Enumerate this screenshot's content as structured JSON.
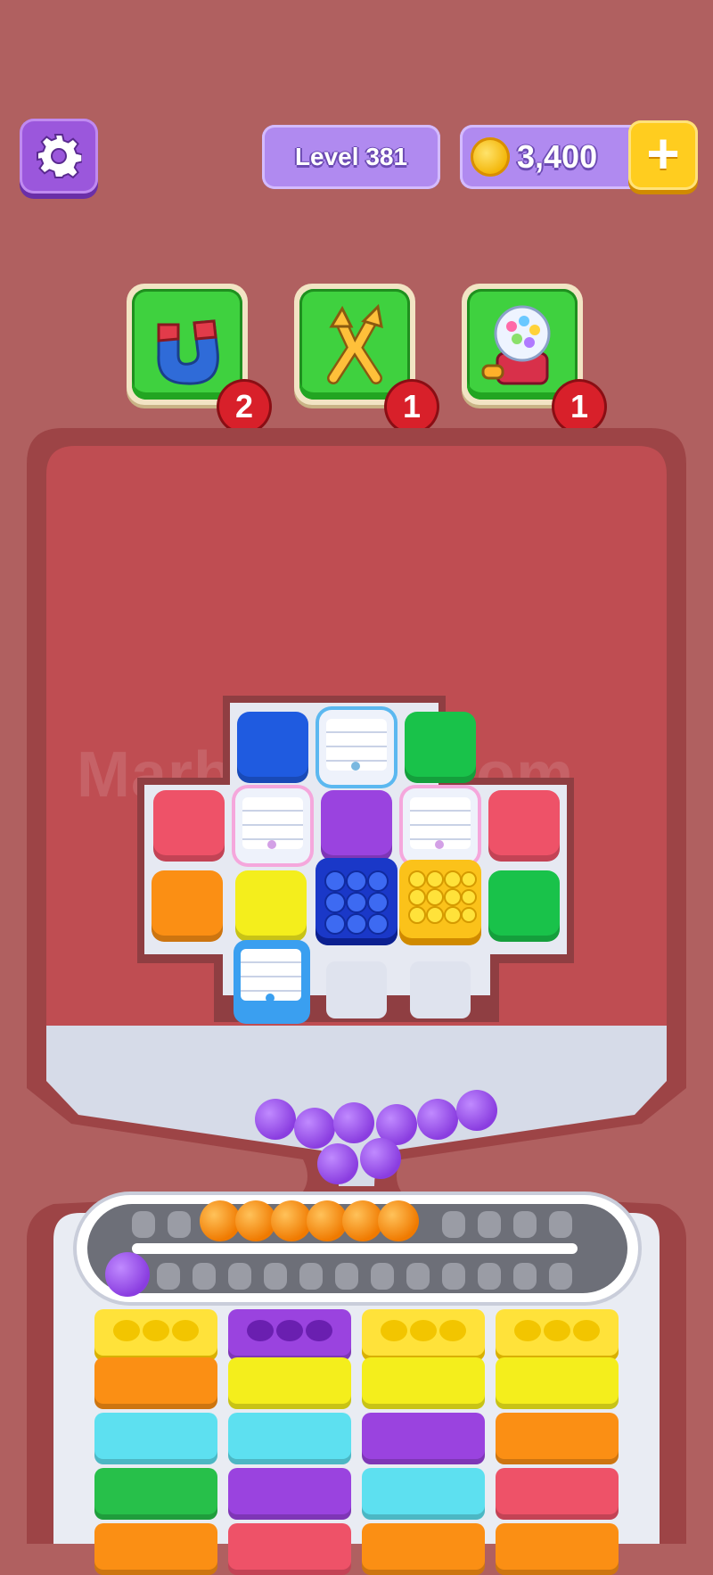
{
  "hud": {
    "level_label": "Level 381",
    "coins": "3,400",
    "plus_label": "+"
  },
  "boosters": [
    {
      "name": "magnet",
      "count": "2"
    },
    {
      "name": "shuffle",
      "count": "1"
    },
    {
      "name": "gumball-machine",
      "count": "1"
    }
  ],
  "watermark": "MarbleSort.com",
  "colors": {
    "background": "#b06060",
    "accent_purple": "#9b57dc",
    "booster_green": "#3fd13f",
    "badge_red": "#d8202a"
  },
  "board": {
    "rows": [
      [
        "",
        "blue",
        "crate-blue",
        "green",
        ""
      ],
      [
        "red",
        "crate-pink",
        "purple",
        "crate-pink",
        "red"
      ],
      [
        "orange",
        "yellow",
        "pop-blue",
        "pop-yellow",
        "green"
      ],
      [
        "",
        "crate-blue",
        "empty",
        "empty",
        ""
      ]
    ]
  },
  "queue_balls": [
    "purple",
    "purple",
    "purple",
    "purple",
    "purple",
    "purple",
    "purple",
    "purple"
  ],
  "conveyor_balls": [
    "orange",
    "orange",
    "orange",
    "orange",
    "orange",
    "orange"
  ],
  "conveyor_loose_ball": "purple",
  "columns": [
    [
      "yellow",
      "orange",
      "cyan",
      "green",
      "orange"
    ],
    [
      "purple",
      "yellow",
      "cyan",
      "purple",
      "red"
    ],
    [
      "yellow",
      "yellow",
      "purple",
      "cyan",
      "orange"
    ],
    [
      "yellow",
      "yellow",
      "orange",
      "red",
      "orange"
    ]
  ]
}
